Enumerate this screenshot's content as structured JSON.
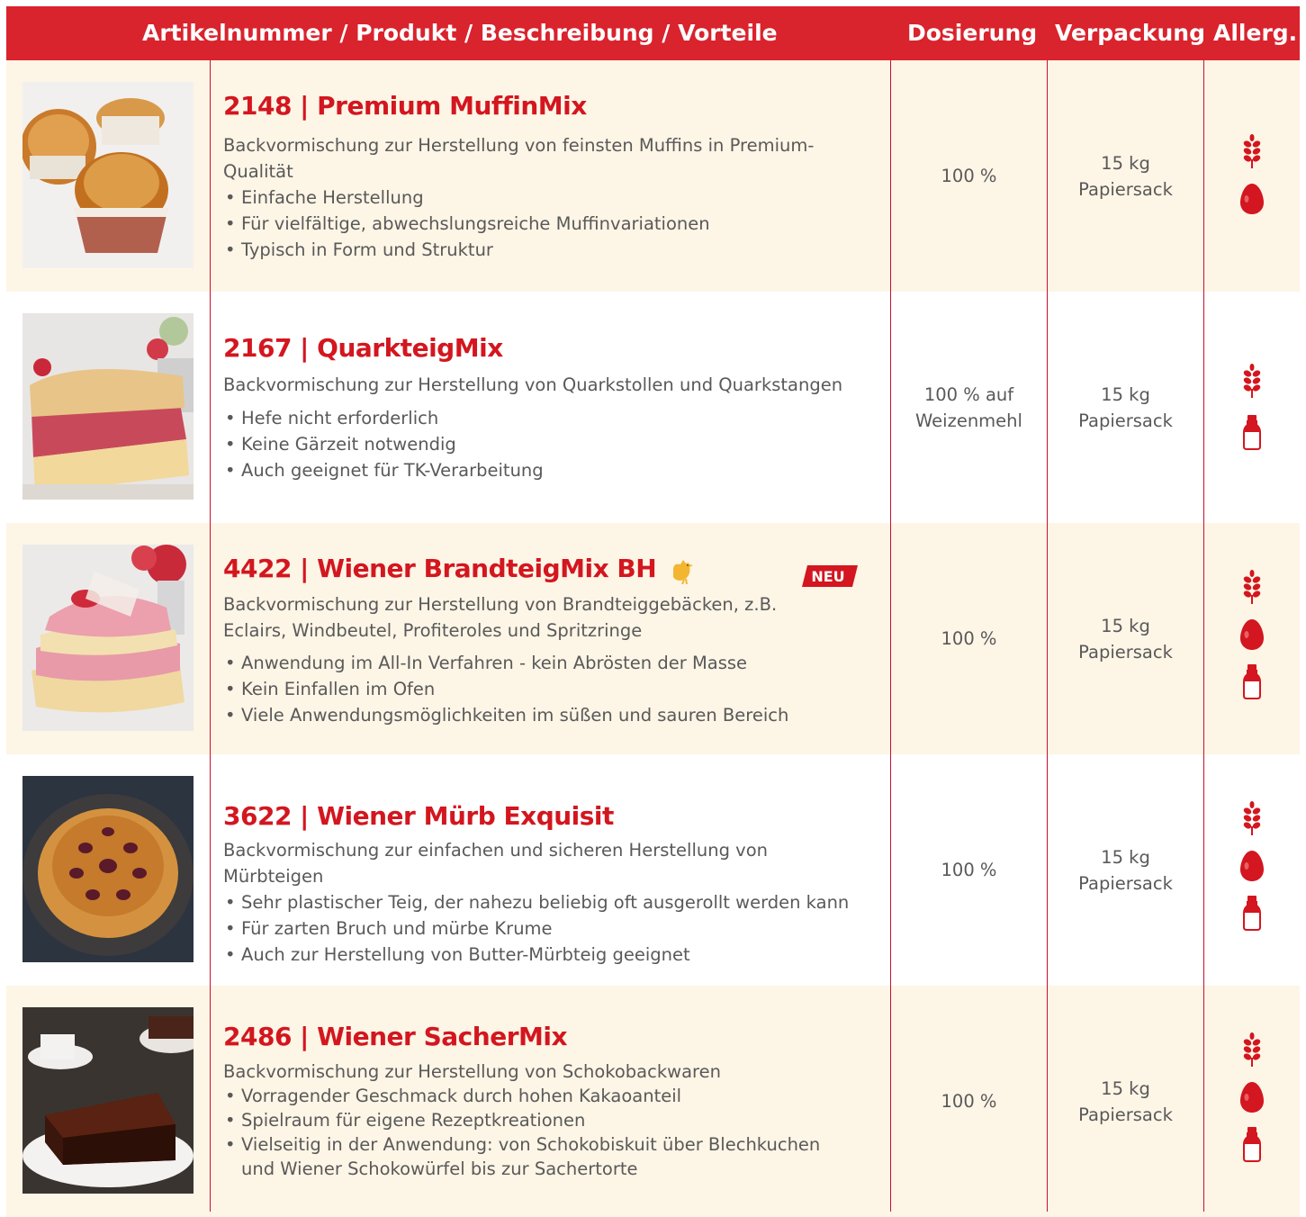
{
  "header": {
    "col_product": "Artikelnummer / Produkt / Beschreibung / Vorteile",
    "col_dosage": "Dosierung",
    "col_packaging": "Verpackung",
    "col_allergens": "Allerg."
  },
  "colors": {
    "brand_red": "#d9232d",
    "row_tint": "#fdf5e6",
    "text": "#595959",
    "neu_badge": "#d3161f"
  },
  "products": [
    {
      "title": "2148 | Premium MuffinMix",
      "description": "Backvormischung zur Herstellung von feinsten Muffins in Premium-Qualität",
      "bullets": [
        "Einfache Herstellung",
        "Für vielfältige, abwechslungsreiche Muffinvariationen",
        "Typisch in Form und Struktur"
      ],
      "dosage": "100 %",
      "pack_line1": "15 kg",
      "pack_line2": "Papiersack",
      "allergens": [
        "wheat-icon",
        "egg-icon"
      ],
      "photo": "muffin-photo"
    },
    {
      "title": "2167 | QuarkteigMix",
      "description": "Backvormischung zur Herstellung von Quarkstollen und Quarkstangen",
      "bullets": [
        "Hefe nicht erforderlich",
        "Keine Gärzeit notwendig",
        "Auch geeignet für TK-Verarbeitung"
      ],
      "dosage": "100 % auf Weizenmehl",
      "dosage_line1": "100 % auf",
      "dosage_line2": "Weizenmehl",
      "pack_line1": "15 kg",
      "pack_line2": "Papiersack",
      "allergens": [
        "wheat-icon",
        "milk-icon"
      ],
      "photo": "crumble-cake-photo"
    },
    {
      "title": "4422 | Wiener BrandteigMix BH",
      "badge": "NEU",
      "description": "Backvormischung zur Herstellung von Brandteiggebäcken, z.B. Eclairs, Windbeutel, Profiteroles und Spritzringe",
      "bullets": [
        "Anwendung im All-In Verfahren - kein Abrösten der Masse",
        "Kein Einfallen im Ofen",
        "Viele Anwendungsmöglichkeiten im süßen und sauren Bereich"
      ],
      "dosage": "100 %",
      "pack_line1": "15 kg",
      "pack_line2": "Papiersack",
      "allergens": [
        "wheat-icon",
        "egg-icon",
        "milk-icon"
      ],
      "photo": "strawberry-pastry-photo"
    },
    {
      "title": "3622 | Wiener Mürb Exquisit",
      "description": "Backvormischung zur einfachen und sicheren Herstellung von Mürbteigen",
      "bullets": [
        "Sehr plastischer Teig, der nahezu beliebig oft ausgerollt werden kann",
        "Für zarten Bruch und mürbe Krume",
        "Auch zur Herstellung von Butter-Mürbteig geeignet"
      ],
      "dosage": "100 %",
      "pack_line1": "15 kg",
      "pack_line2": "Papiersack",
      "allergens": [
        "wheat-icon",
        "egg-icon",
        "milk-icon"
      ],
      "photo": "tart-photo"
    },
    {
      "title": "2486 | Wiener SacherMix",
      "description": "Backvormischung zur Herstellung von Schokobackwaren",
      "bullets": [
        "Vorragender Geschmack durch hohen Kakaoanteil",
        "Spielraum für eigene Rezeptkreationen",
        "Vielseitig in der Anwendung: von Schokobiskuit über Blechkuchen und Wiener Schokowürfel bis zur Sachertorte"
      ],
      "dosage": "100 %",
      "pack_line1": "15 kg",
      "pack_line2": "Papiersack",
      "allergens": [
        "wheat-icon",
        "egg-icon",
        "milk-icon"
      ],
      "photo": "sacher-cake-photo"
    }
  ]
}
